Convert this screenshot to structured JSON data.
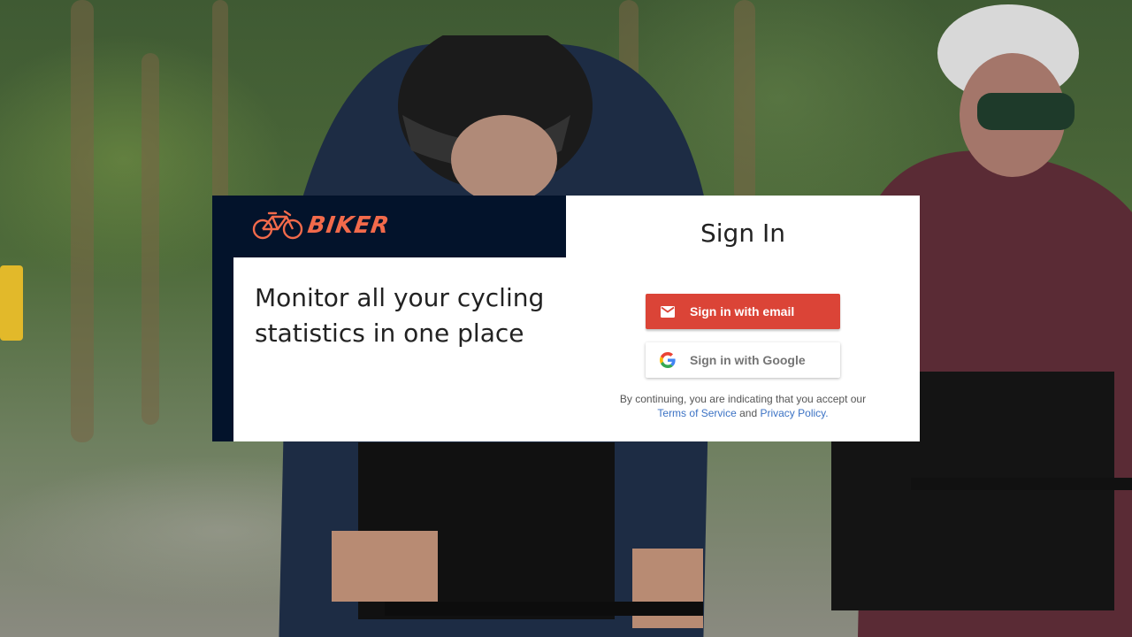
{
  "brand": {
    "logo_text": "BIKER",
    "logo_icon": "bicycle-icon",
    "accent_color": "#f26a4b",
    "panel_color": "#03132b"
  },
  "hero": {
    "tagline": "Monitor all your cycling statistics in one place"
  },
  "signin": {
    "title": "Sign In",
    "email_button": {
      "label": "Sign in with email",
      "icon": "mail-icon",
      "color": "#db4437"
    },
    "google_button": {
      "label": "Sign in with Google",
      "icon": "google-icon"
    },
    "legal": {
      "prefix": "By continuing, you are indicating that you accept our",
      "terms_link": "Terms of Service",
      "conjunction": "and",
      "privacy_link": "Privacy Policy",
      "suffix": "."
    }
  }
}
